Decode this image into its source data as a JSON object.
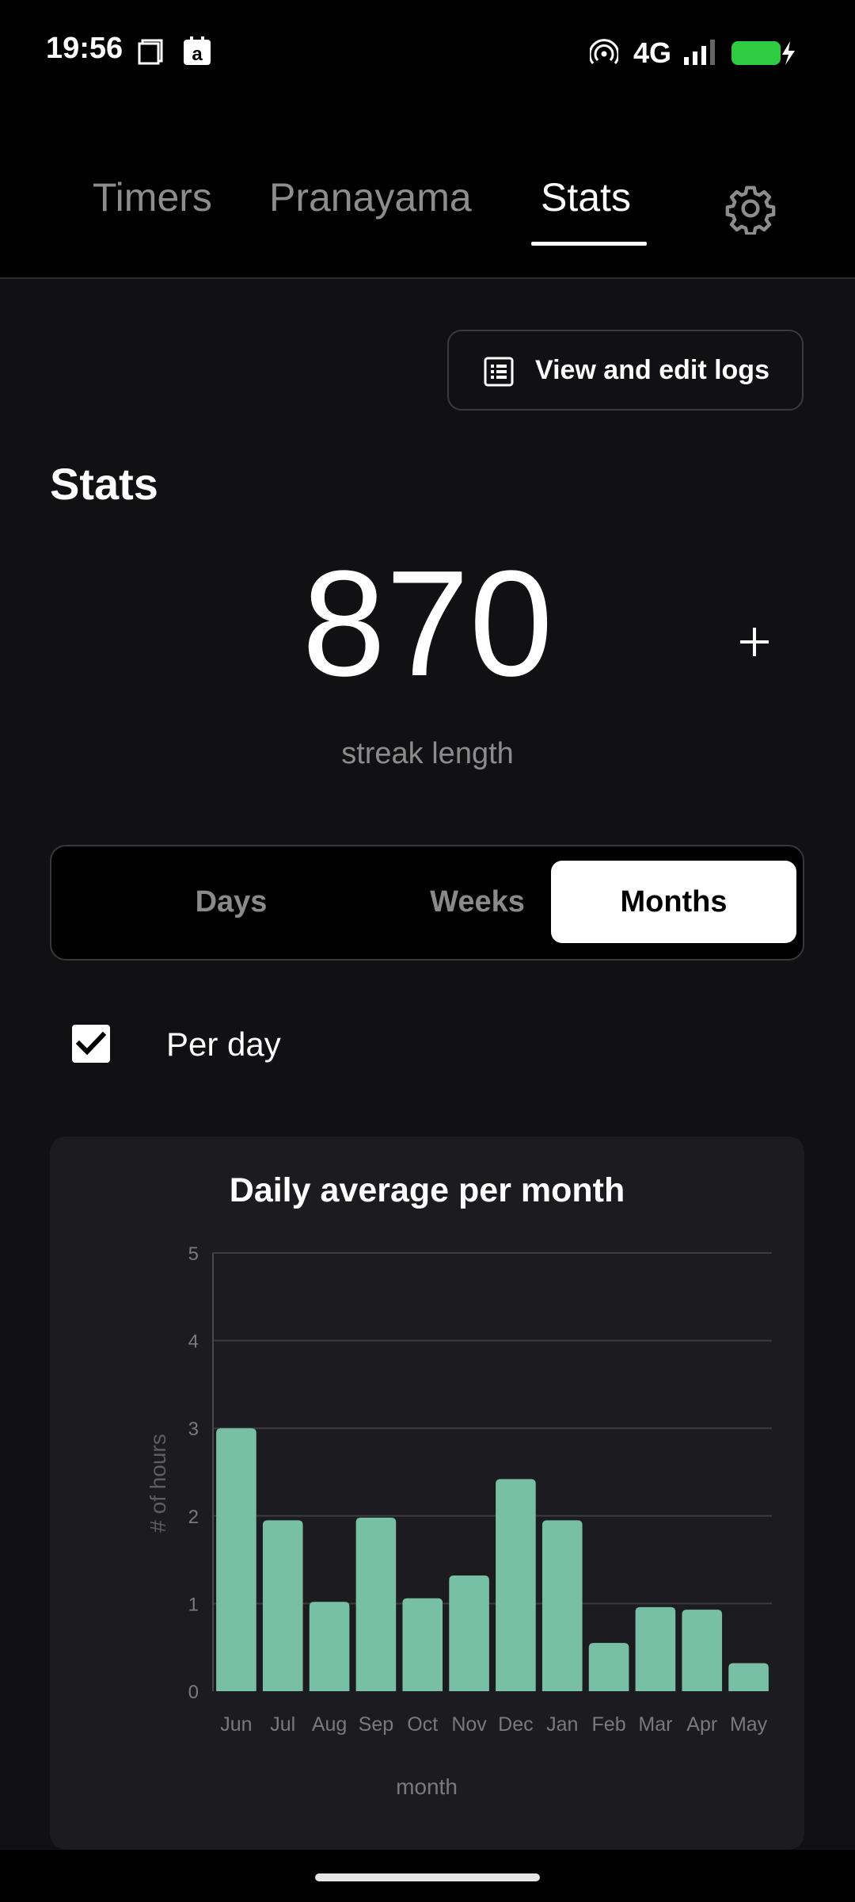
{
  "status_bar": {
    "time": "19:56",
    "network": "4G",
    "icons": [
      "screenshot-icon",
      "amazon-app-icon",
      "hotspot-icon",
      "signal-icon",
      "battery-charging-icon"
    ],
    "battery_color": "#2ecc40"
  },
  "nav": {
    "tabs": [
      {
        "label": "Timers",
        "active": false
      },
      {
        "label": "Pranayama",
        "active": false
      },
      {
        "label": "Stats",
        "active": true
      }
    ],
    "settings_icon": "gear-icon"
  },
  "logs_button": {
    "label": "View and edit logs",
    "icon": "list-icon"
  },
  "section_title": "Stats",
  "streak": {
    "value": "870",
    "label": "streak length"
  },
  "plus_icon": "plus-icon",
  "period_toggle": {
    "options": [
      "Days",
      "Weeks",
      "Months"
    ],
    "selected": "Months"
  },
  "per_day": {
    "label": "Per day",
    "checked": true
  },
  "chart_data": {
    "type": "bar",
    "title": "Daily average per month",
    "xlabel": "month",
    "ylabel": "# of hours",
    "categories": [
      "Jun",
      "Jul",
      "Aug",
      "Sep",
      "Oct",
      "Nov",
      "Dec",
      "Jan",
      "Feb",
      "Mar",
      "Apr",
      "May"
    ],
    "values": [
      3.0,
      1.95,
      1.02,
      1.98,
      1.06,
      1.32,
      2.42,
      1.95,
      0.55,
      0.96,
      0.93,
      0.32
    ],
    "ylim": [
      0,
      5
    ],
    "yticks": [
      "0",
      "1",
      "2",
      "3",
      "4",
      "5"
    ],
    "grid": true,
    "bar_color": "#78c0a5"
  }
}
